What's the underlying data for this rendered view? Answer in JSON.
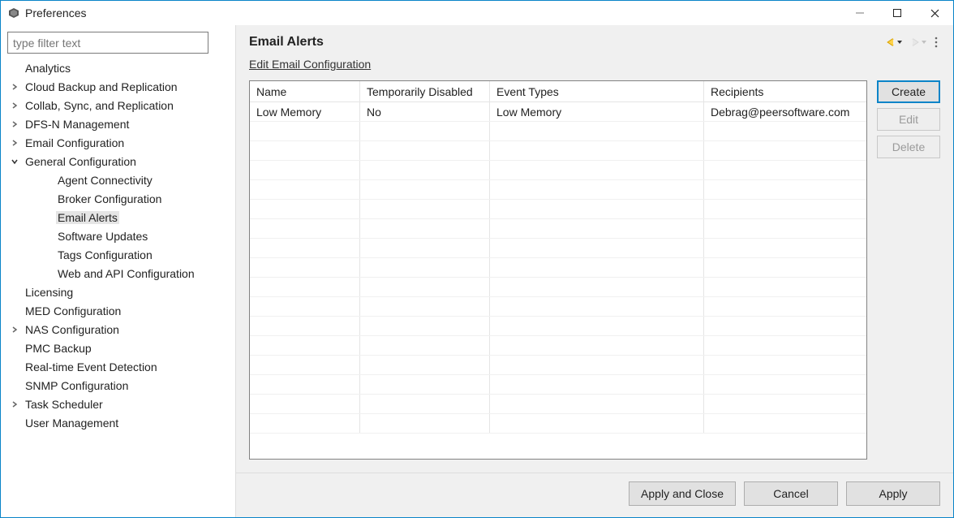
{
  "window": {
    "title": "Preferences"
  },
  "sidebar": {
    "filter_placeholder": "type filter text",
    "items": [
      "Analytics",
      "Cloud Backup and Replication",
      "Collab, Sync, and Replication",
      "DFS-N Management",
      "Email Configuration",
      "General Configuration",
      "Licensing",
      "MED Configuration",
      "NAS Configuration",
      "PMC Backup",
      "Real-time Event Detection",
      "SNMP Configuration",
      "Task Scheduler",
      "User Management"
    ],
    "general_children": [
      "Agent Connectivity",
      "Broker Configuration",
      "Email Alerts",
      "Software Updates",
      "Tags Configuration",
      "Web and API Configuration"
    ]
  },
  "main": {
    "title": "Email Alerts",
    "edit_link": "Edit Email Configuration",
    "table": {
      "headers": [
        "Name",
        "Temporarily Disabled",
        "Event Types",
        "Recipients"
      ],
      "rows": [
        {
          "name": "Low Memory",
          "disabled": "No",
          "event_types": "Low Memory",
          "recipients": "Debrag@peersoftware.com"
        }
      ]
    },
    "buttons": {
      "create": "Create",
      "edit": "Edit",
      "delete": "Delete"
    }
  },
  "footer": {
    "apply_close": "Apply and Close",
    "cancel": "Cancel",
    "apply": "Apply"
  }
}
